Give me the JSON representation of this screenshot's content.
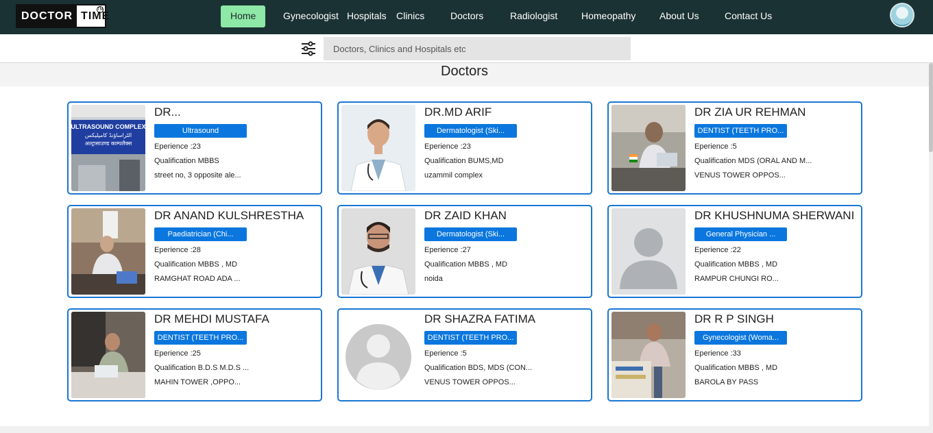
{
  "header": {
    "logo_part1": "DOCTOR",
    "logo_part2": "TIME",
    "logo_tm": "TM",
    "nav": [
      {
        "label": "Home",
        "active": true
      },
      {
        "label": "Gynecologist"
      },
      {
        "label": "Hospitals"
      },
      {
        "label": "Clinics"
      },
      {
        "label": "Doctors"
      },
      {
        "label": "Radiologist"
      },
      {
        "label": "Homeopathy"
      },
      {
        "label": "About Us"
      },
      {
        "label": "Contact Us"
      }
    ]
  },
  "search": {
    "placeholder": "Doctors, Clinics and Hospitals etc",
    "icon": "filter-sliders-icon"
  },
  "page": {
    "title": "Doctors"
  },
  "colors": {
    "topbar": "#1b3234",
    "active_nav": "#8ee8a6",
    "card_border": "#1976d2",
    "badge": "#0b77de"
  },
  "doctors": [
    {
      "name": "DR...",
      "speciality": "Ultrasound",
      "experience": "Eperience :23",
      "qualification": "Qualification MBBS",
      "address": "street no, 3 opposite ale...",
      "photo": "ultrasound-sign"
    },
    {
      "name": "DR.MD ARIF",
      "speciality": "Dermatologist (Ski...",
      "experience": "Eperience :23",
      "qualification": "Qualification BUMS,MD",
      "address": "uzammil complex",
      "photo": "doctor-white-coat"
    },
    {
      "name": "DR ZIA UR REHMAN",
      "speciality": "DENTIST (TEETH PRO...",
      "experience": "Eperience :5",
      "qualification": "Qualification MDS (ORAL AND M...",
      "address": "VENUS TOWER OPPOS...",
      "photo": "doctor-at-desk"
    },
    {
      "name": "DR ANAND KULSHRESTHA",
      "speciality": "Paediatrician (Chi...",
      "experience": "Eperience :28",
      "qualification": "Qualification MBBS , MD",
      "address": "RAMGHAT ROAD ADA ...",
      "photo": "doctor-office"
    },
    {
      "name": "DR ZAID KHAN",
      "speciality": "Dermatologist (Ski...",
      "experience": "Eperience :27",
      "qualification": "Qualification MBBS , MD",
      "address": "noida",
      "photo": "doctor-stethoscope"
    },
    {
      "name": "DR KHUSHNUMA SHERWANI",
      "speciality": "General Physician ...",
      "experience": "Eperience :22",
      "qualification": "Qualification MBBS , MD",
      "address": "RAMPUR CHUNGI RO...",
      "photo": "placeholder-person"
    },
    {
      "name": "DR MEHDI MUSTAFA",
      "speciality": "DENTIST (TEETH PRO...",
      "experience": "Eperience :25",
      "qualification": "Qualification B.D.S M.D.S ...",
      "address": "MAHIN TOWER ,OPPO...",
      "photo": "doctor-laptop"
    },
    {
      "name": "DR SHAZRA FATIMA",
      "speciality": "DENTIST (TEETH PRO...",
      "experience": "Eperience :5",
      "qualification": "Qualification BDS, MDS (CON...",
      "address": "VENUS TOWER OPPOS...",
      "photo": "placeholder-circle"
    },
    {
      "name": "DR R P SINGH",
      "speciality": "Gynecologist (Woma...",
      "experience": "Eperience :33",
      "qualification": "Qualification MBBS , MD",
      "address": "BAROLA BY PASS",
      "photo": "doctor-clinic"
    }
  ]
}
